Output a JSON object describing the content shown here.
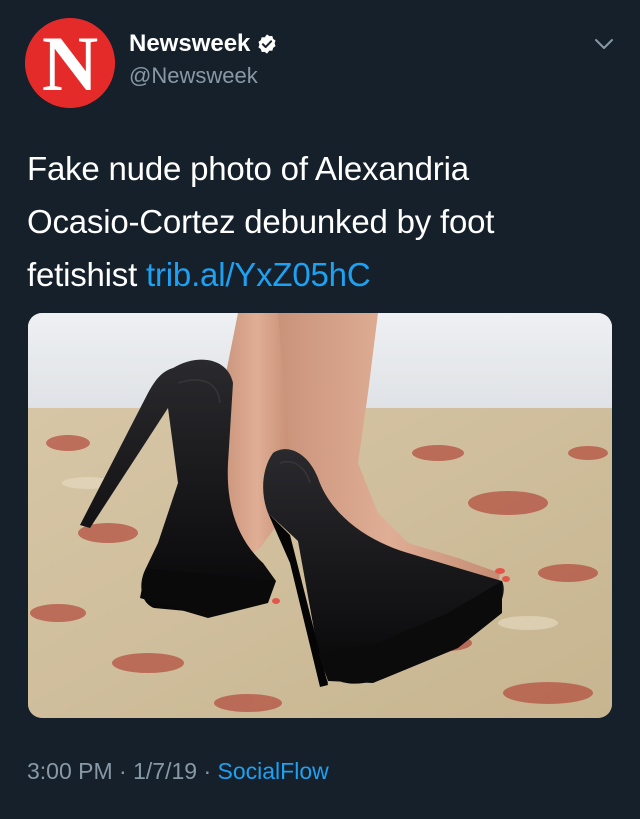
{
  "account": {
    "display_name": "Newsweek",
    "handle": "@Newsweek",
    "avatar_letter": "N",
    "avatar_color": "#e52a2a",
    "verified_color": "#ffffff"
  },
  "tweet": {
    "text_line1": "Fake nude photo of Alexandria",
    "text_line2": "Ocasio-Cortez debunked by foot",
    "text_line3_plain": "fetishist ",
    "link": "trib.al/YxZ05hC",
    "link_color": "#1da1f2"
  },
  "media": {
    "alt": "photo",
    "icon": "photo-of-high-heels"
  },
  "meta": {
    "time": "3:00 PM",
    "separator": " · ",
    "date": "1/7/19",
    "source": "SocialFlow"
  },
  "icons": {
    "menu": "chevron-down-icon",
    "verified": "verified-badge-icon"
  },
  "colors": {
    "background": "#15202b",
    "secondary_text": "#8899a6"
  }
}
